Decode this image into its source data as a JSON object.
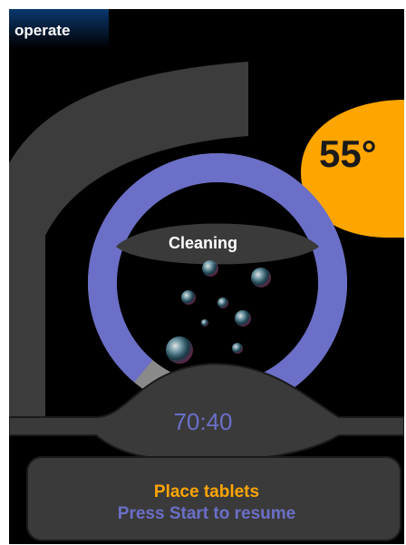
{
  "header": {
    "mode_label": "operate"
  },
  "temperature": {
    "value": "55°",
    "color": "#ffa500"
  },
  "program": {
    "phase_label": "Cleaning",
    "remaining_time": "70:40",
    "progress_fraction": 0.84,
    "progress_color": "#6b6fc8",
    "remaining_color": "#8a8a8a"
  },
  "message": {
    "line1": "Place tablets",
    "line1_color": "#ffa500",
    "line2": "Press Start to resume",
    "line2_color": "#6b6fc8"
  },
  "icons": {
    "bubbles": "bubbles-icon"
  }
}
